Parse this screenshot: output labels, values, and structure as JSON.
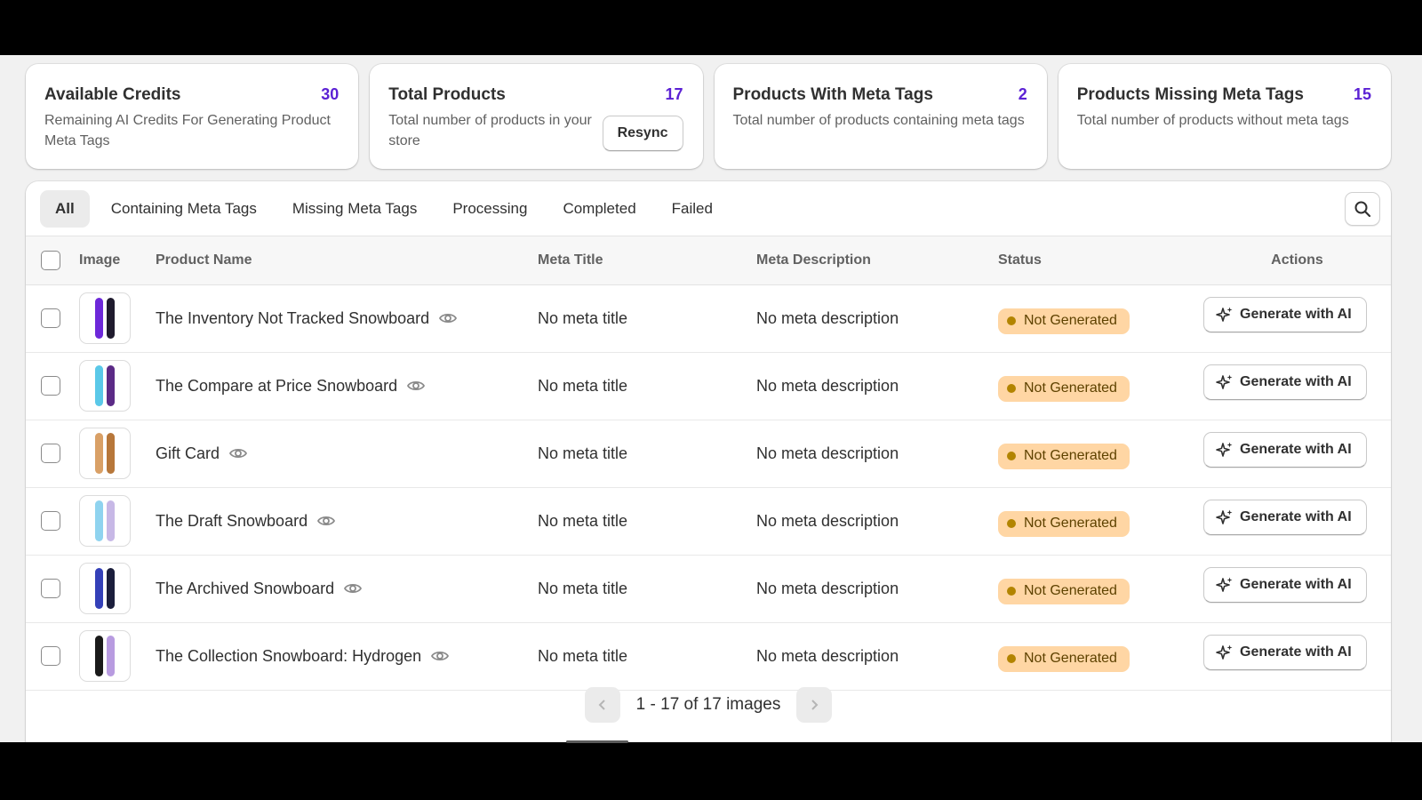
{
  "cards": [
    {
      "title": "Available Credits",
      "value": "30",
      "desc": "Remaining AI Credits For Generating Product Meta Tags"
    },
    {
      "title": "Total Products",
      "value": "17",
      "desc": "Total number of products in your store",
      "button": "Resync"
    },
    {
      "title": "Products With Meta Tags",
      "value": "2",
      "desc": "Total number of products containing meta tags"
    },
    {
      "title": "Products Missing Meta Tags",
      "value": "15",
      "desc": "Total number of products without meta tags"
    }
  ],
  "tabs": [
    "All",
    "Containing Meta Tags",
    "Missing Meta Tags",
    "Processing",
    "Completed",
    "Failed"
  ],
  "active_tab": "All",
  "table": {
    "headers": {
      "image": "Image",
      "name": "Product Name",
      "meta_title": "Meta Title",
      "meta_desc": "Meta Description",
      "status": "Status",
      "actions": "Actions"
    },
    "rows": [
      {
        "name": "The Inventory Not Tracked Snowboard",
        "meta_title": "No meta title",
        "meta_desc": "No meta description",
        "status": "Not Generated",
        "action": "Generate with AI",
        "thumb": [
          "#6d28d9",
          "#1f1b2e"
        ]
      },
      {
        "name": "The Compare at Price Snowboard",
        "meta_title": "No meta title",
        "meta_desc": "No meta description",
        "status": "Not Generated",
        "action": "Generate with AI",
        "thumb": [
          "#5ac8e8",
          "#5b2a86"
        ]
      },
      {
        "name": "Gift Card",
        "meta_title": "No meta title",
        "meta_desc": "No meta description",
        "status": "Not Generated",
        "action": "Generate with AI",
        "thumb": [
          "#d9a066",
          "#b7773a"
        ]
      },
      {
        "name": "The Draft Snowboard",
        "meta_title": "No meta title",
        "meta_desc": "No meta description",
        "status": "Not Generated",
        "action": "Generate with AI",
        "thumb": [
          "#8fd3ef",
          "#c7b8e6"
        ]
      },
      {
        "name": "The Archived Snowboard",
        "meta_title": "No meta title",
        "meta_desc": "No meta description",
        "status": "Not Generated",
        "action": "Generate with AI",
        "thumb": [
          "#3440b8",
          "#1b1e3c"
        ]
      },
      {
        "name": "The Collection Snowboard: Hydrogen",
        "meta_title": "No meta title",
        "meta_desc": "No meta description",
        "status": "Not Generated",
        "action": "Generate with AI",
        "thumb": [
          "#1a1a1a",
          "#b89be0"
        ]
      }
    ]
  },
  "pagination": {
    "text": "1 - 17 of 17 images"
  },
  "colors": {
    "accent": "#5b21d4",
    "badge_bg": "#ffd6a4",
    "badge_dot": "#b28400"
  }
}
